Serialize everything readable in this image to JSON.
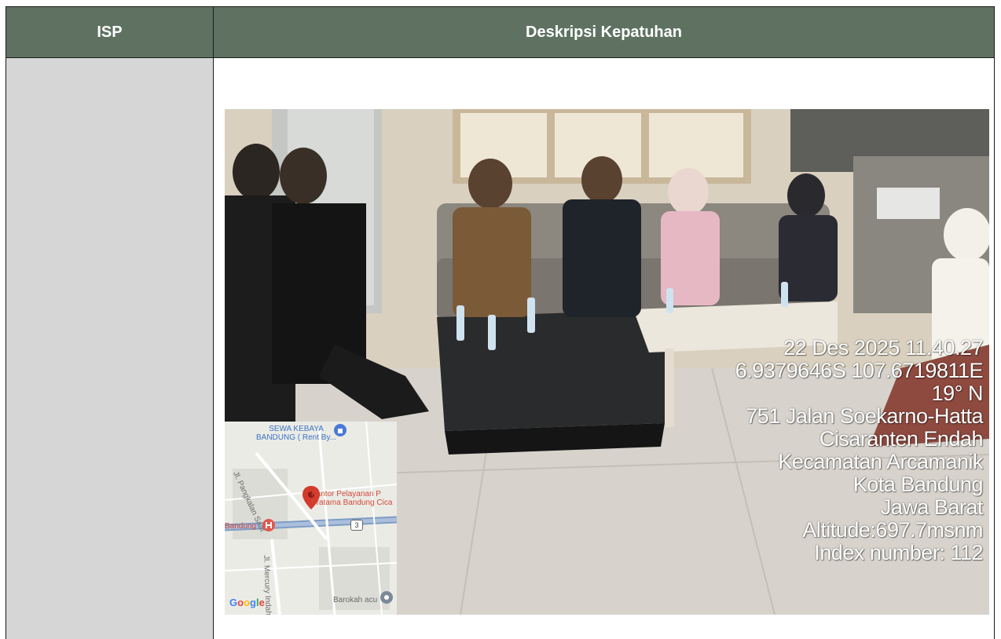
{
  "table": {
    "headers": {
      "isp": "ISP",
      "description": "Deskripsi Kepatuhan"
    }
  },
  "photo": {
    "geotag": {
      "datetime": "22 Des 2025 11.40.27",
      "coordinates": "6.9379646S 107.6719811E",
      "heading": "19° N",
      "street": "751 Jalan Soekarno-Hatta",
      "village": "Cisaranten Endah",
      "district": "Kecamatan Arcamanik",
      "city": "Kota Bandung",
      "province": "Jawa Barat",
      "altitude": "Altitude:697.7msnm",
      "index": "Index number: 112"
    },
    "map": {
      "poi_top_line1": "SEWA KEBAYA",
      "poi_top_line2": "BANDUNG ( Rent By...",
      "street_1": "Jl. Pangkalan Saat",
      "poi_main_line1": "Kantor Pelayanan P",
      "poi_main_line2": "Pratama Bandung Cica",
      "poi_left": "Bandung",
      "road_badge": "3",
      "street_2": "Jl. Mercury Indah",
      "poi_bottom": "Barokah acu",
      "google_letters": [
        "G",
        "o",
        "o",
        "g",
        "l",
        "e"
      ]
    }
  },
  "colors": {
    "header_bg": "#5f7262",
    "header_text": "#ffffff",
    "isp_cell_bg": "#d6d6d6"
  }
}
